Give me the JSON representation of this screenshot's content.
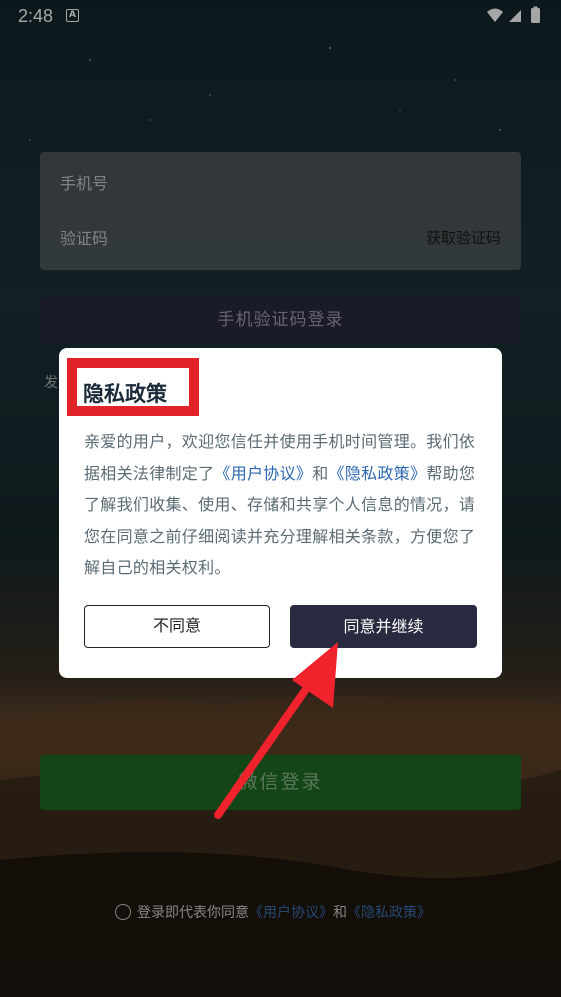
{
  "status_bar": {
    "time": "2:48",
    "notification_icon": "A"
  },
  "login_form": {
    "phone_placeholder": "手机号",
    "code_placeholder": "验证码",
    "get_code_label": "获取验证码"
  },
  "phone_login_button": "手机验证码登录",
  "partial_text": "发",
  "wechat_login_button": "微信登录",
  "agreement": {
    "prefix": "登录即代表你同意",
    "user_agreement": "《用户协议》",
    "and": "和",
    "privacy_policy": "《隐私政策》"
  },
  "dialog": {
    "title": "隐私政策",
    "body_part1": "亲爱的用户，欢迎您信任并使用手机时间管理。我们依据相关法律制定了",
    "link_user_agreement": "《用户协议》",
    "body_and": "和",
    "link_privacy_policy": "《隐私政策》",
    "body_part2": "帮助您了解我们收集、使用、存储和共享个人信息的情况，请您在同意之前仔细阅读并充分理解相关条款，方便您了解自己的相关权利。",
    "disagree_label": "不同意",
    "agree_label": "同意并继续"
  },
  "colors": {
    "accent": "#282a40",
    "highlight": "#e0242a",
    "link": "#2c67b2",
    "wechat": "#1f6a22"
  }
}
